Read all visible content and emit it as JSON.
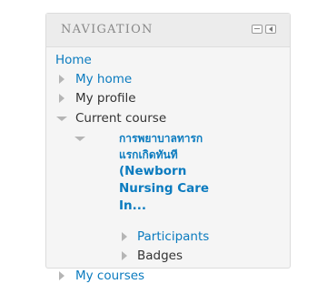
{
  "navigation": {
    "title": "NAVIGATION",
    "items": {
      "home": "Home",
      "my_home": "My home",
      "my_profile": "My profile",
      "current_course": "Current course",
      "course_name_lines": [
        "การพยาบาลทารก",
        "แรกเกิดทันที",
        "(Newborn",
        "Nursing Care",
        "In..."
      ],
      "participants": "Participants",
      "badges": "Badges",
      "my_courses": "My courses"
    }
  }
}
